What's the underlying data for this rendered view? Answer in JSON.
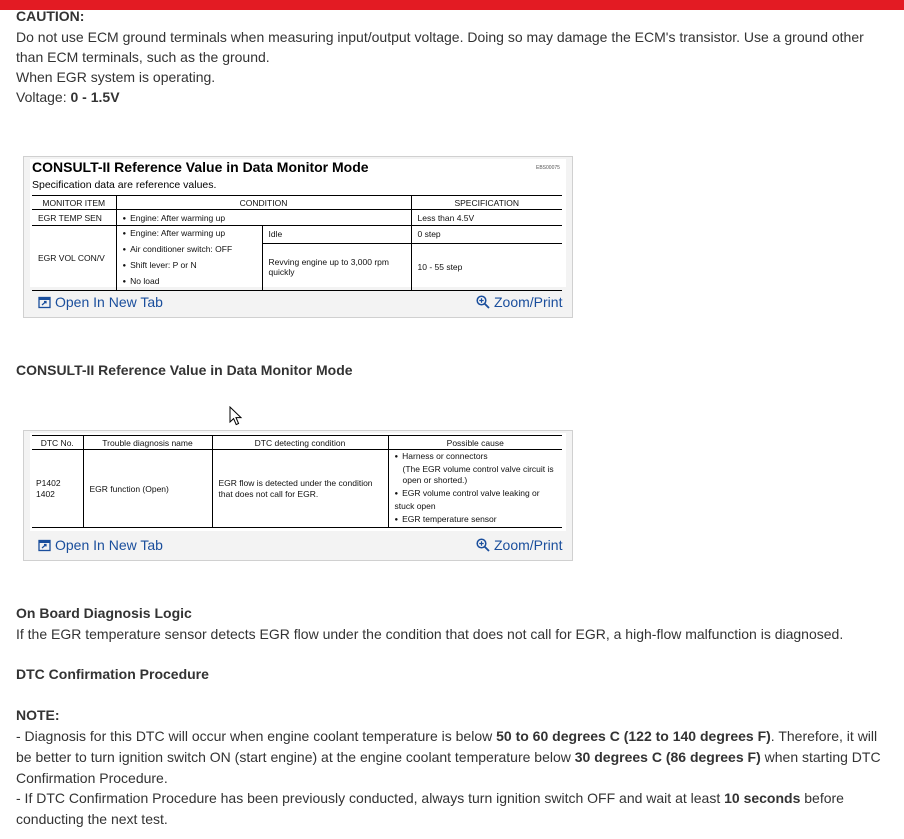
{
  "caution": {
    "heading": "CAUTION:",
    "line1": "Do not use ECM ground terminals when measuring input/output voltage. Doing so may damage the ECM's transistor. Use a ground other than ECM terminals, such as the ground.",
    "line2": "When EGR system is operating.",
    "voltage_label": "Voltage: ",
    "voltage_value": "0 - 1.5V"
  },
  "figure1": {
    "title": "CONSULT-II Reference Value in Data Monitor Mode",
    "code": "EBS00075",
    "subtitle": "Specification data are reference values.",
    "headers": [
      "MONITOR ITEM",
      "CONDITION",
      "SPECIFICATION"
    ],
    "row1": {
      "item": "EGR TEMP SEN",
      "condition": "Engine: After warming up",
      "spec": "Less than 4.5V"
    },
    "row2": {
      "item": "EGR VOL CON/V",
      "conditions": [
        "Engine: After warming up",
        "Air conditioner switch: OFF",
        "Shift lever: P or N",
        "No load"
      ],
      "sub1": "Idle",
      "spec1": "0 step",
      "sub2": "Revving engine up to 3,000 rpm quickly",
      "spec2": "10 - 55 step"
    },
    "open_label": "Open In New Tab",
    "zoom_label": "Zoom/Print"
  },
  "section_title": "CONSULT-II Reference Value in Data Monitor Mode",
  "figure2": {
    "headers": [
      "DTC No.",
      "Trouble diagnosis name",
      "DTC detecting condition",
      "Possible cause"
    ],
    "dtc1": "P1402",
    "dtc2": "1402",
    "name": "EGR function (Open)",
    "condition": "EGR flow is detected under the condition that does not call for EGR.",
    "causes": [
      "Harness or connectors",
      "(The EGR volume control valve circuit is open or shorted.)",
      "EGR volume control valve leaking or stuck open",
      "EGR temperature sensor"
    ],
    "open_label": "Open In New Tab",
    "zoom_label": "Zoom/Print"
  },
  "obd": {
    "heading": "On Board Diagnosis Logic",
    "text": "If the EGR temperature sensor detects EGR flow under the condition that does not call for EGR, a high-flow malfunction is diagnosed."
  },
  "dtc_heading": "DTC Confirmation Procedure",
  "note": {
    "heading": "NOTE:",
    "p1_a": " -  Diagnosis for this DTC will occur when engine coolant temperature is below ",
    "p1_b": "50 to 60 degrees C (122 to 140 degrees F)",
    "p1_c": ". Therefore, it will be better to turn ignition switch ON (start engine) at the engine coolant temperature below ",
    "p1_d": "30 degrees C (86 degrees F)",
    "p1_e": " when starting DTC Confirmation Procedure.",
    "p2_a": " -  If DTC Confirmation Procedure has been previously conducted, always turn ignition switch OFF and wait at least ",
    "p2_b": "10 seconds",
    "p2_c": " before conducting the next test."
  },
  "icons": {
    "open": "open-in-new-tab-icon",
    "zoom": "zoom-magnifier-icon",
    "cursor": "mouse-pointer-icon"
  },
  "colors": {
    "top_bar": "#e31b23",
    "link": "#1a4e9c"
  }
}
